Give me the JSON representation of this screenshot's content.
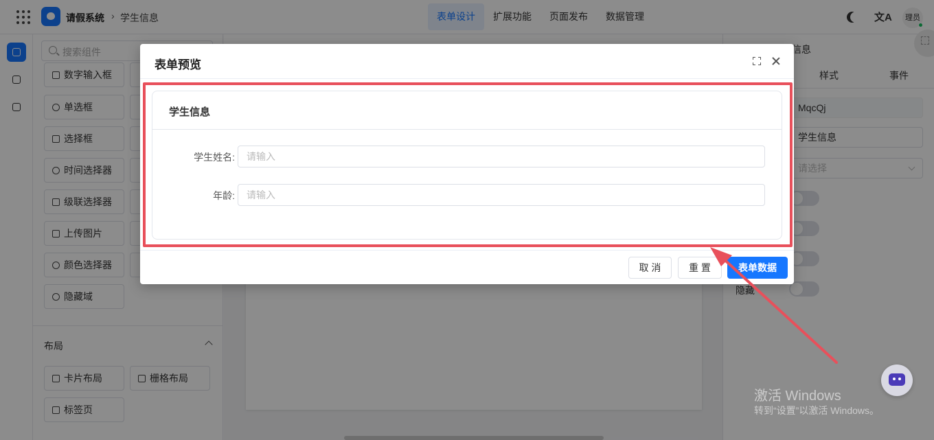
{
  "header": {
    "app_title": "请假系统",
    "breadcrumb_sep": "›",
    "breadcrumb": "学生信息",
    "nav": [
      "表单设计",
      "扩展功能",
      "页面发布",
      "数据管理"
    ],
    "active_nav": "表单设计",
    "user": "理员"
  },
  "components": {
    "search_placeholder": "搜索组件",
    "items": [
      "数字输入框",
      "单选框",
      "选择框",
      "时间选择器",
      "级联选择器",
      "上传图片",
      "颜色选择器",
      "隐藏域"
    ],
    "layout_section": "布局",
    "layout_items": [
      "卡片布局",
      "栅格布局",
      "标签页"
    ]
  },
  "props": {
    "header_suffix": "信息",
    "tabs": [
      "样式",
      "事件"
    ],
    "id_value": "MqcQj",
    "title_value": "学生信息",
    "select_placeholder": "请选择",
    "hidden_label": "隐藏"
  },
  "dialog": {
    "title": "表单预览",
    "card_title": "学生信息",
    "fields": [
      {
        "label": "学生姓名:",
        "placeholder": "请输入"
      },
      {
        "label": "年龄:",
        "placeholder": "请输入"
      }
    ],
    "buttons": {
      "cancel": "取 消",
      "reset": "重 置",
      "submit": "表单数据"
    }
  },
  "watermark": {
    "line1": "激活 Windows",
    "line2": "转到“设置”以激活 Windows。"
  },
  "colors": {
    "primary": "#1677ff",
    "annotation": "#e8505b"
  }
}
